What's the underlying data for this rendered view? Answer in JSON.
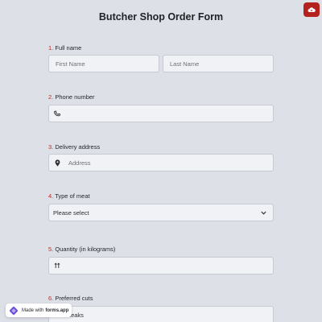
{
  "form": {
    "title": "Butcher Shop Order Form"
  },
  "questions": {
    "full_name": {
      "number": "1.",
      "label": "Full name",
      "first_placeholder": "First Name",
      "last_placeholder": "Last Name"
    },
    "phone": {
      "number": "2.",
      "label": "Phone number"
    },
    "address": {
      "number": "3.",
      "label": "Delivery address",
      "placeholder": "Address"
    },
    "meat": {
      "number": "4.",
      "label": "Type of meat",
      "selected": "Please select"
    },
    "quantity": {
      "number": "5.",
      "label": "Quantity (in kilograms)",
      "value": ""
    },
    "cuts": {
      "number": "6.",
      "label": "Preferred cuts",
      "value": "Steaks"
    }
  },
  "branding": {
    "made_with": "Made with",
    "brand": "forms.app"
  },
  "icons": {
    "corner": "cloud-icon",
    "phone": "phone-icon",
    "address": "location-pin-icon",
    "dropdown": "chevron-down-icon",
    "quantity": "sort-arrows-icon",
    "brand": "forms-app-logo-icon"
  },
  "colors": {
    "background": "#dde0e7",
    "accent": "#c0281f",
    "corner_button": "#b3221c",
    "input_bg": "#f1f2f6",
    "brand_purple": "#6b4fd8"
  }
}
